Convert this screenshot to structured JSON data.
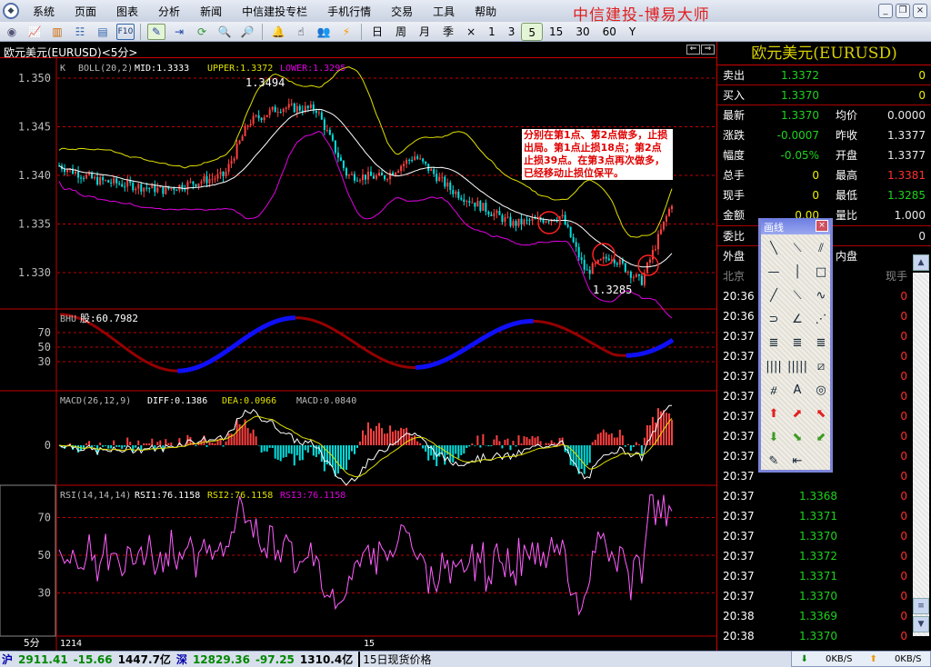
{
  "menu": [
    "系统",
    "页面",
    "图表",
    "分析",
    "新闻",
    "中信建投专栏",
    "手机行情",
    "交易",
    "工具",
    "帮助"
  ],
  "brand": "中信建投-博易大师",
  "toolbar": {
    "periods": [
      "日",
      "周",
      "月",
      "季",
      "×",
      "1",
      "3",
      "5",
      "15",
      "30",
      "60",
      "Y"
    ],
    "active_period": "5"
  },
  "chart": {
    "title": "欧元美元(EURUSD)<5分>",
    "k_legend": {
      "k": "K",
      "boll": "BOLL(20,2)",
      "mid": "MID:1.3333",
      "upper": "UPPER:1.3372",
      "lower": "LOWER:1.3295"
    },
    "price_ticks": [
      "1.350",
      "1.345",
      "1.340",
      "1.335",
      "1.330"
    ],
    "high_label": "1.3494",
    "low_label": "1.3285",
    "annotation": "分别在第1点、第2点做多，止损出局。第1点止损18点；第2点止损39点。在第3点再次做多，已经移动止损位保平。",
    "bhu_legend": {
      "name": "BHU",
      "value": "股:60.7982"
    },
    "bhu_ticks": [
      "70",
      "50",
      "30"
    ],
    "macd_legend": {
      "name": "MACD(26,12,9)",
      "diff": "DIFF:0.1386",
      "dea": "DEA:0.0966",
      "macd": "MACD:0.0840"
    },
    "macd_ticks": [
      "0"
    ],
    "rsi_legend": {
      "name": "RSI(14,14,14)",
      "rsi1": "RSI1:76.1158",
      "rsi2": "RSI2:76.1158",
      "rsi3": "RSI3:76.1158"
    },
    "rsi_ticks": [
      "70",
      "50",
      "30"
    ],
    "period_label": "5分",
    "x_ticks": [
      "1214",
      "15"
    ]
  },
  "quote": {
    "title": "欧元美元(EURUSD)",
    "sell": {
      "label": "卖出",
      "price": "1.3372",
      "vol": "0"
    },
    "buy": {
      "label": "买入",
      "price": "1.3370",
      "vol": "0"
    },
    "rows": [
      {
        "l": "最新",
        "v": "1.3370",
        "l2": "均价",
        "v2": "0.0000"
      },
      {
        "l": "涨跌",
        "v": "-0.0007",
        "l2": "昨收",
        "v2": "1.3377"
      },
      {
        "l": "幅度",
        "v": "-0.05%",
        "l2": "开盘",
        "v2": "1.3377"
      },
      {
        "l": "总手",
        "v": "0",
        "l2": "最高",
        "v2": "1.3381"
      },
      {
        "l": "现手",
        "v": "0",
        "l2": "最低",
        "v2": "1.3285"
      },
      {
        "l": "金额",
        "v": "0.00",
        "l2": "量比",
        "v2": "1.000"
      }
    ],
    "weibi": {
      "label": "委比",
      "value": "0"
    },
    "waipan": {
      "label": "外盘",
      "l2": "内盘",
      "value": "---"
    },
    "trade_header": {
      "place": "北京",
      "vol": "现手"
    },
    "trades": [
      {
        "t": "20:36",
        "p": "",
        "v": "0"
      },
      {
        "t": "20:36",
        "p": "",
        "v": "0"
      },
      {
        "t": "20:37",
        "p": "",
        "v": "0"
      },
      {
        "t": "20:37",
        "p": "",
        "v": "0"
      },
      {
        "t": "20:37",
        "p": "",
        "v": "0"
      },
      {
        "t": "20:37",
        "p": "",
        "v": "0"
      },
      {
        "t": "20:37",
        "p": "",
        "v": "0"
      },
      {
        "t": "20:37",
        "p": "",
        "v": "0"
      },
      {
        "t": "20:37",
        "p": "",
        "v": "0"
      },
      {
        "t": "20:37",
        "p": "",
        "v": "0"
      },
      {
        "t": "20:37",
        "p": "1.3368",
        "v": "0"
      },
      {
        "t": "20:37",
        "p": "1.3371",
        "v": "0"
      },
      {
        "t": "20:37",
        "p": "1.3370",
        "v": "0"
      },
      {
        "t": "20:37",
        "p": "1.3372",
        "v": "0"
      },
      {
        "t": "20:37",
        "p": "1.3371",
        "v": "0"
      },
      {
        "t": "20:37",
        "p": "1.3370",
        "v": "0"
      },
      {
        "t": "20:38",
        "p": "1.3369",
        "v": "0"
      },
      {
        "t": "20:38",
        "p": "1.3370",
        "v": "0"
      }
    ]
  },
  "toolbox": {
    "title": "画线",
    "tools": [
      {
        "n": "line-icon",
        "g": "╲"
      },
      {
        "n": "segment-icon",
        "g": "⟍"
      },
      {
        "n": "parallel-lines-icon",
        "g": "⫽"
      },
      {
        "n": "horizontal-line-icon",
        "g": "—"
      },
      {
        "n": "vertical-line-icon",
        "g": "│"
      },
      {
        "n": "rectangle-icon",
        "g": "□"
      },
      {
        "n": "ray-icon",
        "g": "╱"
      },
      {
        "n": "arrow-line-icon",
        "g": "⟍"
      },
      {
        "n": "wave-icon",
        "g": "∿"
      },
      {
        "n": "arc-icon",
        "g": "⊃"
      },
      {
        "n": "angle-icon",
        "g": "∠"
      },
      {
        "n": "fan-icon",
        "g": "⋰"
      },
      {
        "n": "gann-icon",
        "g": "≣"
      },
      {
        "n": "percent-icon",
        "g": "≣"
      },
      {
        "n": "fibonacci-icon",
        "g": "≣"
      },
      {
        "n": "cycle-lines-icon",
        "g": "||||"
      },
      {
        "n": "fib-time-icon",
        "g": "|||||"
      },
      {
        "n": "channel-icon",
        "g": "⧄"
      },
      {
        "n": "gann-fan-icon",
        "g": "⧣"
      },
      {
        "n": "text-icon",
        "g": "A"
      },
      {
        "n": "circle-icon",
        "g": "◎"
      },
      {
        "n": "up-arrow-icon",
        "g": "⬆"
      },
      {
        "n": "up-right-arrow-icon",
        "g": "⬈"
      },
      {
        "n": "up-left-arrow-icon",
        "g": "⬉"
      },
      {
        "n": "down-arrow-icon",
        "g": "⬇"
      },
      {
        "n": "down-right-arrow-icon",
        "g": "⬊"
      },
      {
        "n": "down-left-arrow-icon",
        "g": "⬋"
      },
      {
        "n": "eraser-icon",
        "g": "✎"
      },
      {
        "n": "delete-all-icon",
        "g": "⇤"
      }
    ]
  },
  "status": {
    "sh_label": "沪",
    "sh_index": "2911.41",
    "sh_change": "-15.66",
    "sh_amount": "1447.7亿",
    "sz_label": "深",
    "sz_index": "12829.36",
    "sz_change": "-97.25",
    "sz_amount": "1310.4亿",
    "note": "15日现货价格",
    "down_speed": "0KB/S",
    "up_speed": "0KB/S"
  },
  "colors": {
    "up": "#ff4040",
    "down": "#00e0e0",
    "grid": "#c00000",
    "boll_upper": "#e0e000",
    "boll_lower": "#e000e0"
  }
}
